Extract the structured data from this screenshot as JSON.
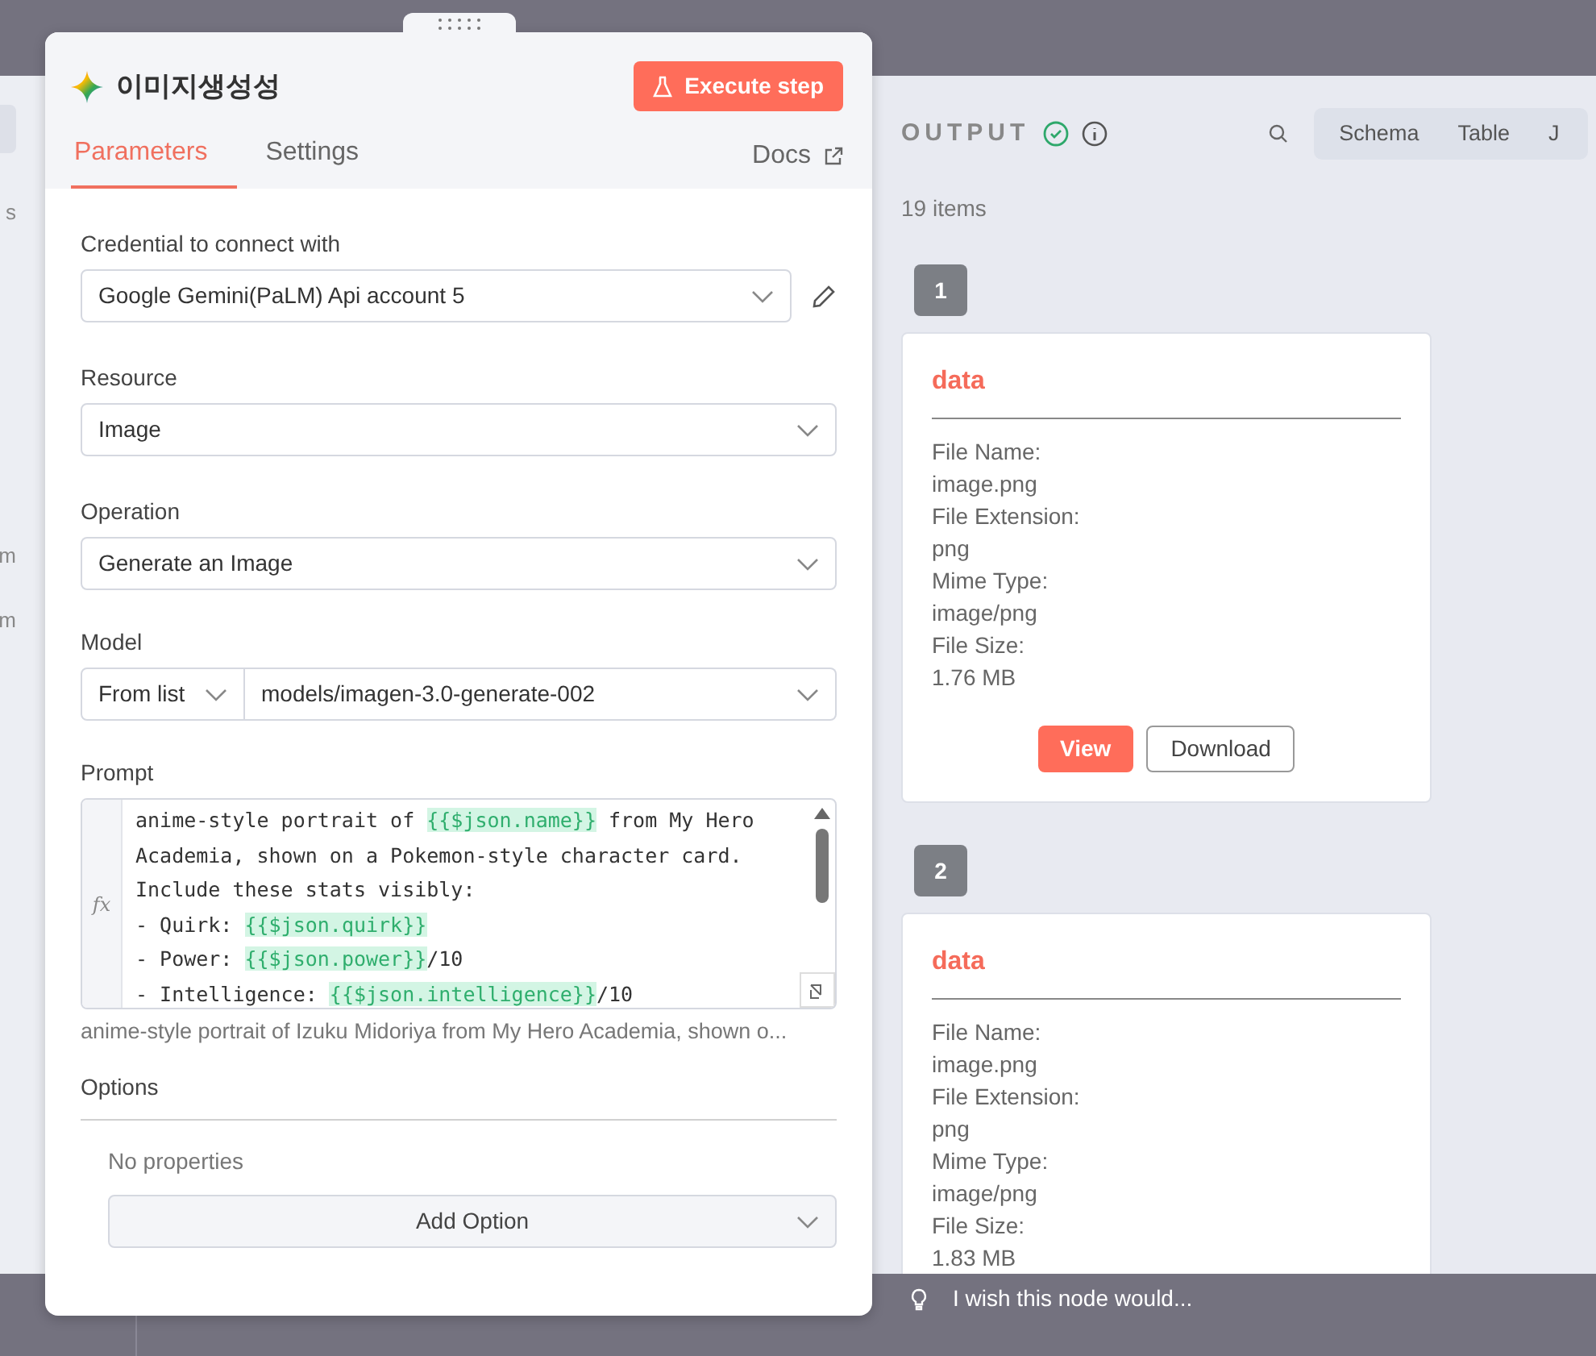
{
  "background_fragments": [
    "s",
    "m",
    "m"
  ],
  "node_panel": {
    "title": "이미지생성성",
    "execute_button": "Execute step",
    "tabs": [
      {
        "label": "Parameters",
        "selected": true
      },
      {
        "label": "Settings",
        "selected": false
      }
    ],
    "docs_link": "Docs",
    "credential": {
      "label": "Credential to connect with",
      "value": "Google Gemini(PaLM) Api account 5"
    },
    "resource": {
      "label": "Resource",
      "value": "Image"
    },
    "operation": {
      "label": "Operation",
      "value": "Generate an Image"
    },
    "model": {
      "label": "Model",
      "mode": "From list",
      "value": "models/imagen-3.0-generate-002"
    },
    "prompt": {
      "label": "Prompt",
      "gutter": "fx",
      "lines": [
        [
          {
            "kind": "plain",
            "text": "anime-style portrait of "
          },
          {
            "kind": "expr",
            "text": "{{$json.name}}"
          },
          {
            "kind": "plain",
            "text": " from My Hero"
          }
        ],
        [
          {
            "kind": "plain",
            "text": "Academia, shown on a Pokemon-style character card."
          }
        ],
        [
          {
            "kind": "plain",
            "text": "Include these stats visibly:"
          }
        ],
        [
          {
            "kind": "plain",
            "text": "- Quirk: "
          },
          {
            "kind": "expr",
            "text": "{{$json.quirk}}"
          }
        ],
        [
          {
            "kind": "plain",
            "text": "- Power: "
          },
          {
            "kind": "expr",
            "text": "{{$json.power}}"
          },
          {
            "kind": "plain",
            "text": "/10"
          }
        ],
        [
          {
            "kind": "plain",
            "text": "- Intelligence: "
          },
          {
            "kind": "expr",
            "text": "{{$json.intelligence}}"
          },
          {
            "kind": "plain",
            "text": "/10"
          }
        ]
      ],
      "preview": "anime-style portrait of Izuku Midoriya from My Hero Academia, shown o..."
    },
    "options": {
      "label": "Options",
      "empty_text": "No properties",
      "add_button": "Add Option"
    }
  },
  "output_panel": {
    "title": "OUTPUT",
    "view_tabs": [
      "Schema",
      "Table",
      "J"
    ],
    "count": "19 items",
    "items": [
      {
        "index": "1",
        "heading": "data",
        "fields": [
          {
            "label": "File Name:",
            "value": "image.png"
          },
          {
            "label": "File Extension:",
            "value": "png"
          },
          {
            "label": "Mime Type:",
            "value": "image/png"
          },
          {
            "label": "File Size:",
            "value": "1.76 MB"
          }
        ],
        "buttons": [
          {
            "kind": "primary",
            "label": "View"
          },
          {
            "kind": "outline",
            "label": "Download"
          }
        ]
      },
      {
        "index": "2",
        "heading": "data",
        "fields": [
          {
            "label": "File Name:",
            "value": "image.png"
          },
          {
            "label": "File Extension:",
            "value": "png"
          },
          {
            "label": "Mime Type:",
            "value": "image/png"
          },
          {
            "label": "File Size:",
            "value": "1.83 MB"
          }
        ]
      }
    ]
  },
  "feedback_bar": {
    "text": "I wish this node would..."
  }
}
